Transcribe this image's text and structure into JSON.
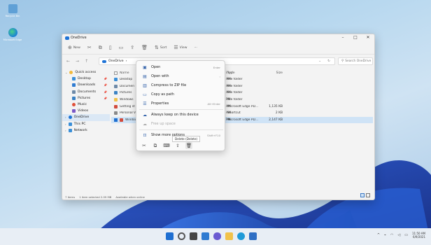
{
  "desktop": {
    "icons": [
      {
        "label": "Recycle Bin"
      },
      {
        "label": "Microsoft Edge"
      }
    ]
  },
  "window": {
    "title": "OneDrive",
    "controls": {
      "minimize": "–",
      "maximize": "□",
      "close": "✕"
    },
    "command_bar": {
      "new_label": "New",
      "sort_label": "Sort",
      "view_label": "View",
      "more_label": "···"
    },
    "address": {
      "location": "OneDrive",
      "separator": "›"
    },
    "search": {
      "placeholder": "Search OneDrive"
    },
    "nav": [
      {
        "label": "Quick access",
        "color": "#f1b93b"
      },
      {
        "label": "Desktop",
        "color": "#3a8fd8",
        "pinned": true
      },
      {
        "label": "Downloads",
        "color": "#2f7bd1",
        "pinned": true
      },
      {
        "label": "Documents",
        "color": "#6e8aa8",
        "pinned": true
      },
      {
        "label": "Pictures",
        "color": "#3b82c4",
        "pinned": true
      },
      {
        "label": "Music",
        "color": "#e0503a"
      },
      {
        "label": "Videos",
        "color": "#7a58c7"
      },
      {
        "label": "OneDrive",
        "color": "#1e73d6",
        "selected": true
      },
      {
        "label": "This PC",
        "color": "#3a8fd8"
      },
      {
        "label": "Network",
        "color": "#3a8fd8"
      }
    ],
    "pin_glyph": "📌",
    "columns": {
      "name": "Name",
      "date": "ified",
      "type": "Type",
      "size": "Size"
    },
    "files": [
      {
        "name": "Desktop",
        "date": "AM",
        "type": "File folder",
        "size": "",
        "color": "#3a8fd8"
      },
      {
        "name": "Documen",
        "date": "AM",
        "type": "File folder",
        "size": "",
        "color": "#6e8aa8"
      },
      {
        "name": "Pictures",
        "date": "AM",
        "type": "File folder",
        "size": "",
        "color": "#3b82c4"
      },
      {
        "name": "Windows",
        "date": "PM",
        "type": "File folder",
        "size": "",
        "color": "#f1c24a"
      },
      {
        "name": "Getting st",
        "date": "AM",
        "type": "Microsoft Edge PD...",
        "size": "1,135 KB",
        "color": "#d24b3c"
      },
      {
        "name": "Personal V",
        "date": "AM",
        "type": "Shortcut",
        "size": "2 KB",
        "color": "#8a8a8a"
      },
      {
        "name": "Windows",
        "date": "PM",
        "type": "Microsoft Edge PD...",
        "size": "2,147 KB",
        "color": "#d24b3c",
        "selected": true
      }
    ],
    "status": {
      "items": "7 items",
      "selected": "1 item selected  2.09 MB",
      "availability": "Available when online"
    }
  },
  "context_menu": {
    "items": [
      {
        "label": "Open",
        "glyph": "▣",
        "shortcut": "Enter"
      },
      {
        "label": "Open with",
        "glyph": "▤",
        "shortcut": "›"
      },
      {
        "label": "Compress to ZIP file",
        "glyph": "▥",
        "shortcut": ""
      },
      {
        "label": "Copy as path",
        "glyph": "▭",
        "shortcut": ""
      },
      {
        "label": "Properties",
        "glyph": "☰",
        "shortcut": "Alt+Enter"
      },
      {
        "label": "Always keep on this device",
        "glyph": "☁",
        "shortcut": ""
      },
      {
        "label": "Free up space",
        "glyph": "☁",
        "shortcut": ""
      },
      {
        "label": "Show more options",
        "glyph": "⊡",
        "shortcut": "Shift+F10"
      }
    ],
    "quick_actions": [
      "✂",
      "⧉",
      "⌨",
      "⇪",
      "🗑"
    ],
    "tooltip": "Delete (Delete)"
  },
  "taskbar": {
    "icons": [
      {
        "name": "start",
        "color": "#1f6fd1"
      },
      {
        "name": "search",
        "color": "#555555"
      },
      {
        "name": "task-view",
        "color": "#444444"
      },
      {
        "name": "widgets",
        "color": "#2f7bd1"
      },
      {
        "name": "chat",
        "color": "#6b5bd1"
      },
      {
        "name": "file-explorer",
        "color": "#f1c24a"
      },
      {
        "name": "edge",
        "color": "#1f9ad8"
      },
      {
        "name": "store",
        "color": "#2f6fc4"
      }
    ],
    "tray": {
      "chevron": "^",
      "time": "11:50 AM",
      "date": "6/9/2021"
    }
  }
}
